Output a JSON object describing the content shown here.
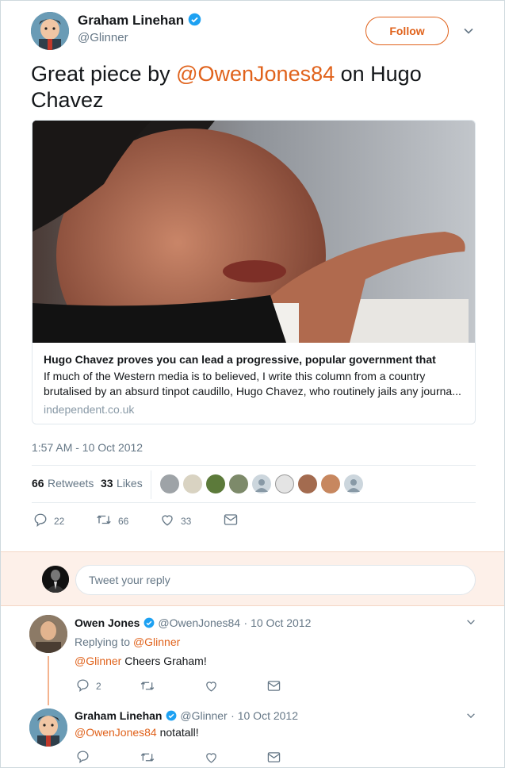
{
  "tweet": {
    "author_name": "Graham Linehan",
    "author_handle": "@Glinner",
    "follow_label": "Follow",
    "text_prefix": "Great piece by ",
    "mention": "@OwenJones84",
    "text_suffix": " on Hugo Chavez",
    "timestamp": "1:57 AM - 10 Oct 2012",
    "card": {
      "title": "Hugo Chavez proves you can lead a progressive, popular government that",
      "description": "If much of the Western media is to believed, I write this column from a country brutalised by an absurd tinpot caudillo, Hugo Chavez, who routinely jails any journa...",
      "domain": "independent.co.uk"
    },
    "stats": {
      "retweets_count": "66",
      "retweets_label": "Retweets",
      "likes_count": "33",
      "likes_label": "Likes"
    },
    "actions": {
      "replies": "22",
      "retweets": "66",
      "likes": "33"
    }
  },
  "compose": {
    "placeholder": "Tweet your reply"
  },
  "replies": [
    {
      "author_name": "Owen Jones",
      "author_handle": "@OwenJones84",
      "date": "· 10 Oct 2012",
      "replying_to_label": "Replying to",
      "replying_to_handle": "@Glinner",
      "mention": "@Glinner",
      "text": " Cheers Graham!",
      "reply_count": "2"
    },
    {
      "author_name": "Graham Linehan",
      "author_handle": "@Glinner",
      "date": "· 10 Oct 2012",
      "mention": "@OwenJones84",
      "text": " notatall!"
    }
  ],
  "colors": {
    "accent": "#e0621b",
    "verified": "#1da1f2",
    "muted": "#657786"
  },
  "icons": [
    "verified-badge-icon",
    "chevron-down-icon",
    "reply-icon",
    "retweet-icon",
    "like-icon",
    "direct-message-icon"
  ]
}
